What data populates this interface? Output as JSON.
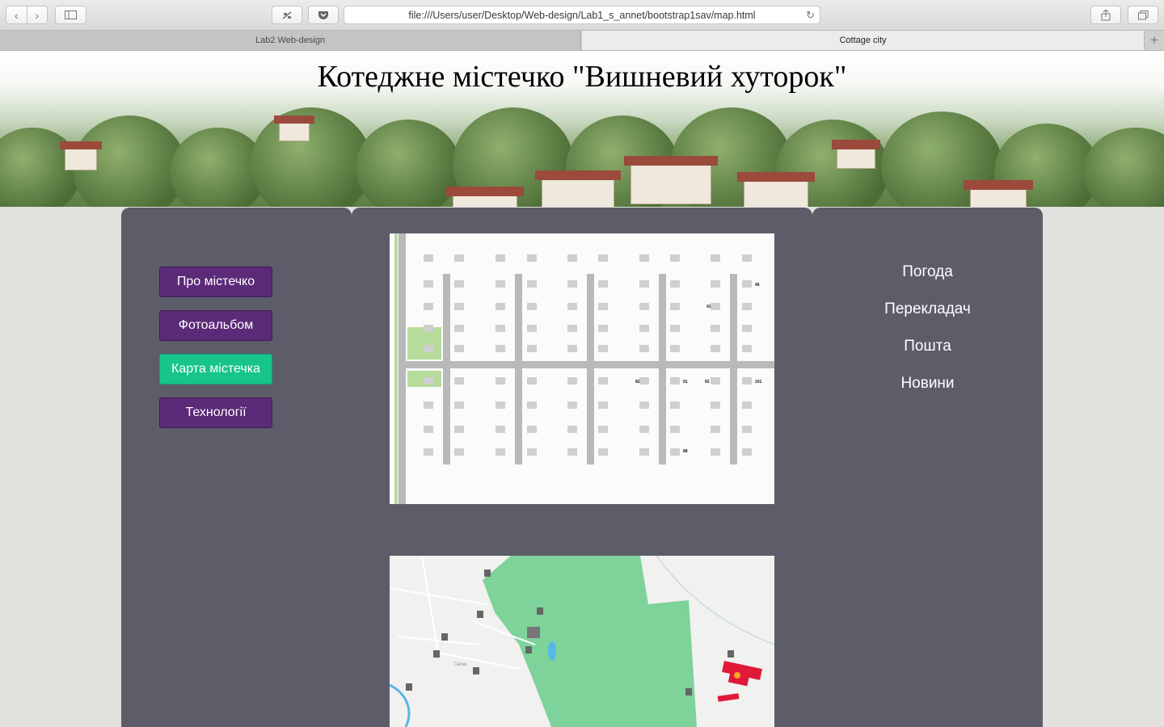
{
  "browser": {
    "url": "file:///Users/user/Desktop/Web-design/Lab1_s_annet/bootstrap1sav/map.html",
    "tabs": [
      {
        "label": "Lab2 Web-design"
      },
      {
        "label": "Cottage city"
      }
    ]
  },
  "header": {
    "title": "Котеджне містечко \"Вишневий хуторок\""
  },
  "left_menu": {
    "items": [
      {
        "label": "Про містечко"
      },
      {
        "label": "Фотоальбом"
      },
      {
        "label": "Карта містечка"
      },
      {
        "label": "Технології"
      }
    ]
  },
  "right_menu": {
    "items": [
      {
        "label": "Погода"
      },
      {
        "label": "Перекладач"
      },
      {
        "label": "Пошта"
      },
      {
        "label": "Новини"
      }
    ]
  },
  "plan": {
    "highlighted_lots": [
      "41",
      "45",
      "82",
      "88",
      "91",
      "92",
      "101"
    ]
  },
  "map": {
    "place_label": "Гатне"
  },
  "colors": {
    "panel": "#5c5d69",
    "menu_button": "#5b2a78",
    "menu_button_active": "#17c58c",
    "page_background": "#e2e1dd"
  }
}
